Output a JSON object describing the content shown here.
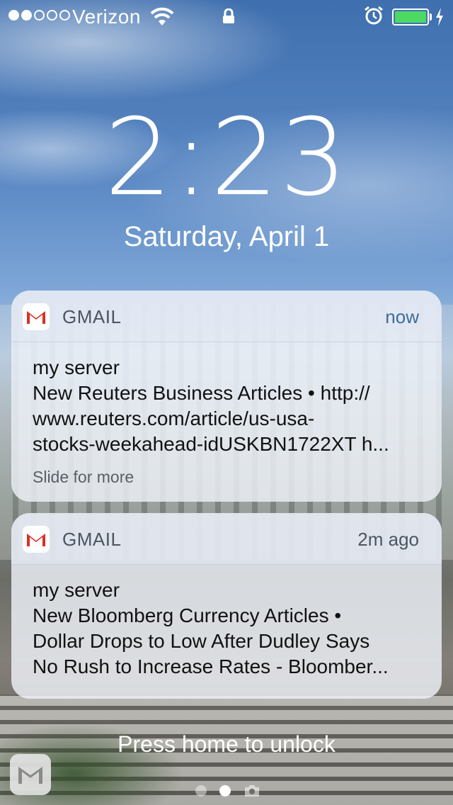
{
  "status_bar": {
    "carrier": "Verizon",
    "signal_bars_filled": 2,
    "signal_bars_total": 5,
    "battery_level": 1.0,
    "battery_color": "#4cd964"
  },
  "lock_screen": {
    "time": "2:23",
    "date": "Saturday, April 1",
    "unlock_hint": "Press home to unlock",
    "page_indicator": {
      "pages": 2,
      "current": 2
    }
  },
  "notifications": [
    {
      "app": "GMAIL",
      "timestamp": "now",
      "title": "my server",
      "lines": [
        "New Reuters Business Articles  •  http://",
        "www.reuters.com/article/us-usa-",
        "stocks-weekahead-idUSKBN1722XT h..."
      ],
      "footer": "Slide for more"
    },
    {
      "app": "GMAIL",
      "timestamp": "2m ago",
      "title": "my server",
      "lines": [
        "New Bloomberg Currency Articles  •",
        "Dollar Drops to Low After Dudley Says",
        "No Rush to Increase Rates - Bloomber..."
      ]
    }
  ],
  "icons": {
    "wifi": "wifi-icon",
    "lock": "lock-icon",
    "alarm": "alarm-icon",
    "battery": "battery-icon",
    "charging": "bolt-icon",
    "gmail": "gmail-icon",
    "camera": "camera-icon"
  },
  "colors": {
    "gmail_red": "#d93025",
    "timestamp_blue": "#3e6b9c"
  }
}
